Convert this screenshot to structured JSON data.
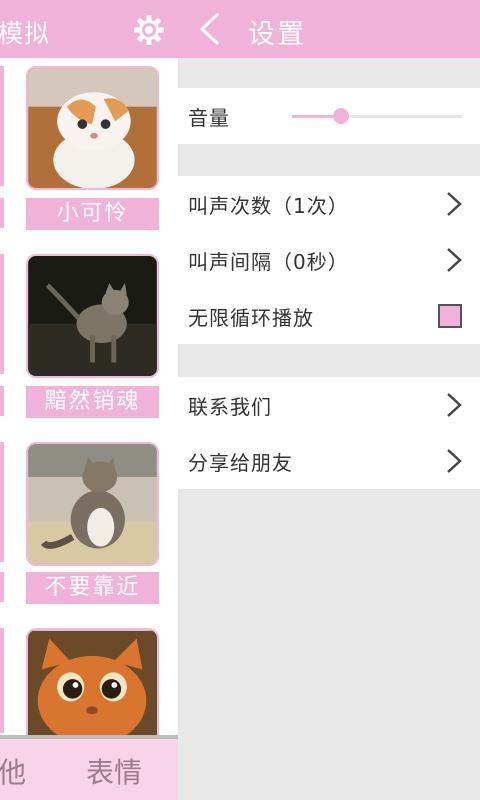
{
  "background_app": {
    "title": "模拟",
    "cards": [
      {
        "caption": "小可怜",
        "image": "cat-photo-white-orange"
      },
      {
        "caption": "黯然销魂",
        "image": "cat-photo-tabby-dark"
      },
      {
        "caption": "不要靠近",
        "image": "cat-photo-tabby-sitting"
      },
      {
        "caption": "",
        "image": "cat-photo-orange-puss"
      }
    ],
    "footer_tabs": [
      "他",
      "表情"
    ]
  },
  "settings": {
    "title": "设置",
    "volume": {
      "label": "音量",
      "level_fraction": 0.29
    },
    "rows": {
      "count_label": "叫声次数（1次）",
      "interval_label": "叫声间隔（0秒）",
      "loop_label": "无限循环播放",
      "loop_checked": true,
      "contact_label": "联系我们",
      "share_label": "分享给朋友"
    }
  },
  "colors": {
    "accent": "#f0b2d8",
    "panel_bg": "#e8e8e8"
  }
}
